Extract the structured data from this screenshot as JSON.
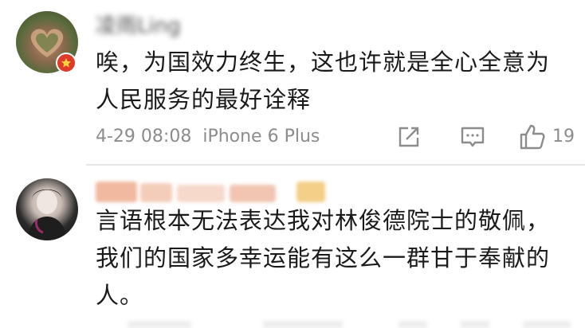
{
  "comments": [
    {
      "username": "凌雨Ling",
      "text_lines": [
        "唉，为国效力终生，这也许就是全心全意为",
        "人民服务的最好诠释"
      ],
      "timestamp": "4-29 08:08",
      "device": "iPhone 6 Plus",
      "like_count": "19",
      "verified_badge_color": "#e03a2b"
    },
    {
      "username": "",
      "text_lines": [
        "言语根本无法表达我对林俊德院士的敬佩，",
        "我们的国家多幸运能有这么一群甘于奉献的",
        "人。"
      ]
    }
  ],
  "icons": {
    "share": "share-icon",
    "reply": "comment-icon",
    "like": "thumbs-up-icon"
  },
  "colors": {
    "text": "#1a1a1a",
    "meta": "#8c8c8c",
    "divider": "#e6e6e6"
  }
}
